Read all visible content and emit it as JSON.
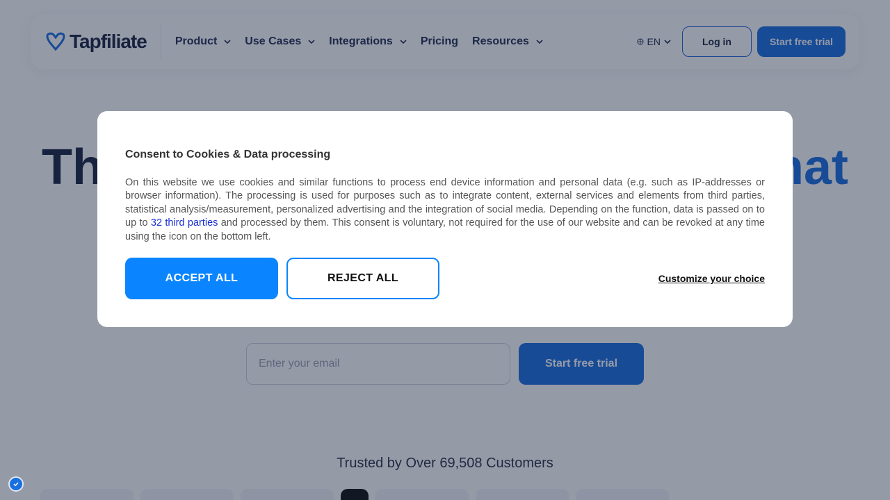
{
  "header": {
    "brand": "Tapfiliate",
    "menu": [
      {
        "label": "Product",
        "has_dropdown": true
      },
      {
        "label": "Use Cases",
        "has_dropdown": true
      },
      {
        "label": "Integrations",
        "has_dropdown": true
      },
      {
        "label": "Pricing",
        "has_dropdown": false
      },
      {
        "label": "Resources",
        "has_dropdown": true
      }
    ],
    "language": "EN",
    "login_label": "Log in",
    "trial_label": "Start free trial"
  },
  "hero": {
    "title_left_fragment": "Th",
    "title_right_fragment": "hat",
    "email_placeholder": "Enter your email",
    "cta_label": "Start free trial",
    "trusted_text": "Trusted by Over 69,508 Customers"
  },
  "consent": {
    "title": "Consent to Cookies & Data processing",
    "body_before_link": "On this website we use cookies and similar functions to process end device information and personal data (e.g. such as IP-addresses or browser information). The processing is used for purposes such as to integrate content, external services and elements from third parties, statistical analysis/measurement, personalized advertising and the integration of social media. Depending on the function, data is passed on to up to ",
    "link_text": "32 third parties",
    "body_after_link": " and processed by them. This consent is voluntary, not required for the use of our website and can be revoked at any time using the icon on the bottom left.",
    "accept_label": "ACCEPT ALL",
    "reject_label": "REJECT ALL",
    "customize_label": "Customize your choice"
  },
  "colors": {
    "accent": "#1a6fe0",
    "consent_accent": "#0a85ff",
    "text_dark": "#1a2540"
  }
}
